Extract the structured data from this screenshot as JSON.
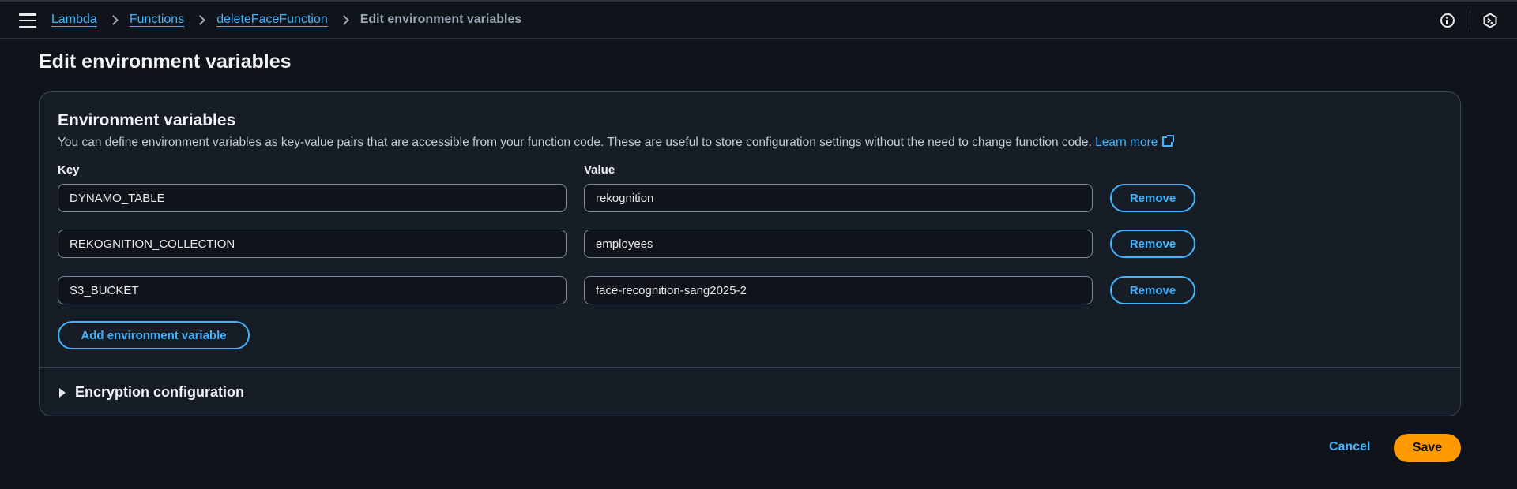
{
  "breadcrumb": {
    "items": [
      "Lambda",
      "Functions",
      "deleteFaceFunction"
    ],
    "current": "Edit environment variables"
  },
  "page": {
    "title": "Edit environment variables"
  },
  "env_panel": {
    "title": "Environment variables",
    "description": "You can define environment variables as key-value pairs that are accessible from your function code. These are useful to store configuration settings without the need to change function code.",
    "learn_more": "Learn more",
    "key_label": "Key",
    "value_label": "Value",
    "rows": [
      {
        "key": "DYNAMO_TABLE",
        "value": "rekognition"
      },
      {
        "key": "REKOGNITION_COLLECTION",
        "value": "employees"
      },
      {
        "key": "S3_BUCKET",
        "value": "face-recognition-sang2025-2"
      }
    ],
    "remove_label": "Remove",
    "add_label": "Add environment variable",
    "encryption_label": "Encryption configuration"
  },
  "footer": {
    "cancel_label": "Cancel",
    "save_label": "Save"
  },
  "colors": {
    "accent": "#42b4ff",
    "primary": "#ff9900",
    "background": "#0f141a",
    "panel": "#161d26"
  }
}
